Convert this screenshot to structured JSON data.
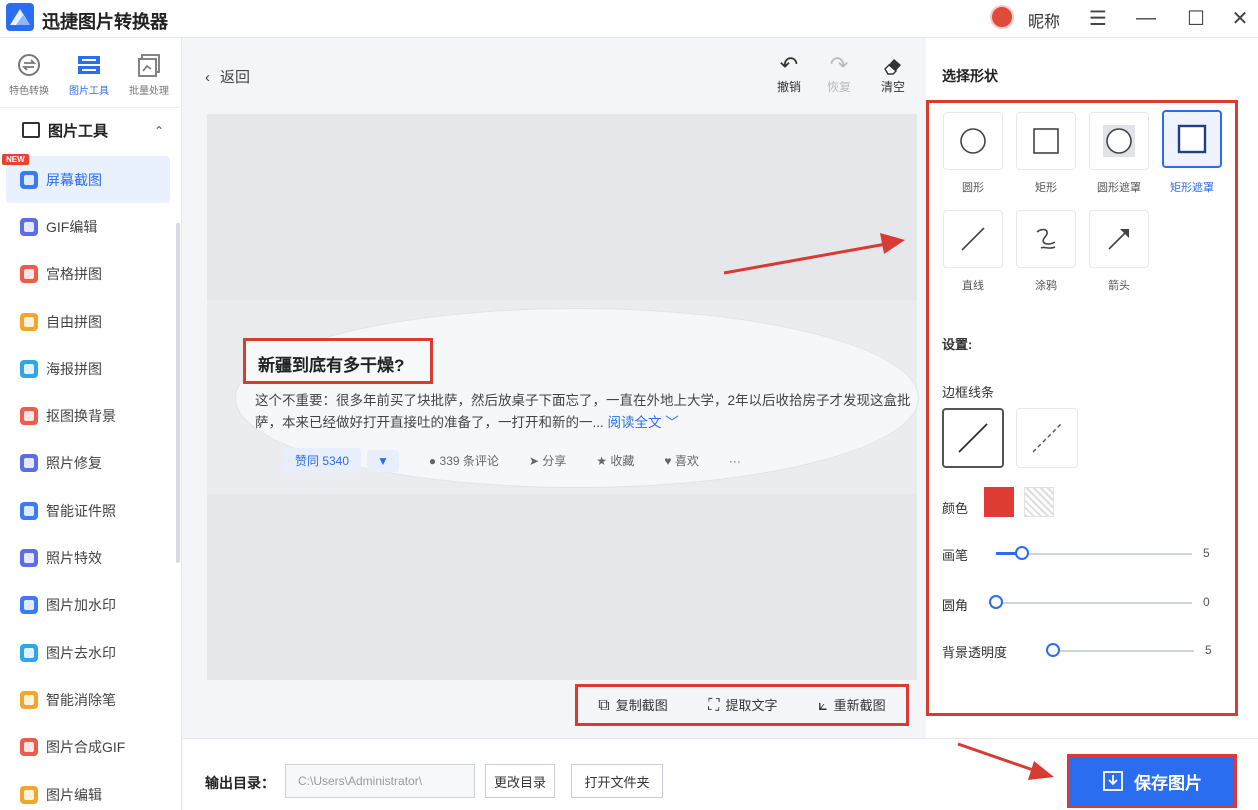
{
  "app": {
    "title": "迅捷图片转换器",
    "user_name": "昵称"
  },
  "window_controls": {
    "menu": "☰",
    "minimize": "—",
    "maximize": "☐",
    "close": "✕"
  },
  "sidebar": {
    "top_tabs": [
      {
        "label": "特色转换"
      },
      {
        "label": "图片工具"
      },
      {
        "label": "批量处理"
      }
    ],
    "section_title": "图片工具",
    "new_badge": "NEW",
    "items": [
      {
        "label": "屏幕截图",
        "color": "#3b7cf6"
      },
      {
        "label": "GIF编辑",
        "color": "#5b6ee8"
      },
      {
        "label": "宫格拼图",
        "color": "#ef5b4c"
      },
      {
        "label": "自由拼图",
        "color": "#f4a52b"
      },
      {
        "label": "海报拼图",
        "color": "#2fa6e8"
      },
      {
        "label": "抠图换背景",
        "color": "#ef5b4c"
      },
      {
        "label": "照片修复",
        "color": "#5b6ee8"
      },
      {
        "label": "智能证件照",
        "color": "#3b7cf6"
      },
      {
        "label": "照片特效",
        "color": "#5b6ee8"
      },
      {
        "label": "图片加水印",
        "color": "#3b7cf6"
      },
      {
        "label": "图片去水印",
        "color": "#2fa6e8"
      },
      {
        "label": "智能消除笔",
        "color": "#f4a52b"
      },
      {
        "label": "图片合成GIF",
        "color": "#ef5b4c"
      },
      {
        "label": "图片编辑",
        "color": "#f4a52b"
      }
    ]
  },
  "main": {
    "back_label": "返回",
    "tools": {
      "undo": "撤销",
      "redo": "恢复",
      "clear": "清空"
    },
    "post": {
      "title": "新疆到底有多干燥?",
      "text": "这个不重要：很多年前买了块批萨，然后放桌子下面忘了，一直在外地上大学，2年以后收拾房子才发现这盒批萨，本来已经做好打开直接吐的准备了，一打开和新的一...",
      "more": "阅读全文 ﹀",
      "vote": "赞同 5340",
      "vote_down": "▼",
      "comments": "339 条评论",
      "share": "分享",
      "collect": "收藏",
      "like": "喜欢",
      "more_dots": "···"
    },
    "bottom_actions": {
      "copy": "复制截图",
      "extract": "提取文字",
      "retake": "重新截图"
    }
  },
  "panel": {
    "title": "选择形状",
    "shapes": [
      "圆形",
      "矩形",
      "圆形遮罩",
      "矩形遮罩",
      "直线",
      "涂鸦",
      "箭头"
    ],
    "settings_title": "设置:",
    "border_label": "边框线条",
    "color_label": "颜色",
    "color_value": "#e03c36",
    "brush_label": "画笔",
    "brush_value": "5",
    "radius_label": "圆角",
    "radius_value": "0",
    "opacity_label": "背景透明度",
    "opacity_value": "5"
  },
  "footer": {
    "output_label": "输出目录：",
    "output_path": "C:\\Users\\Administrator\\",
    "change_dir": "更改目录",
    "open_folder": "打开文件夹",
    "save": "保存图片"
  }
}
